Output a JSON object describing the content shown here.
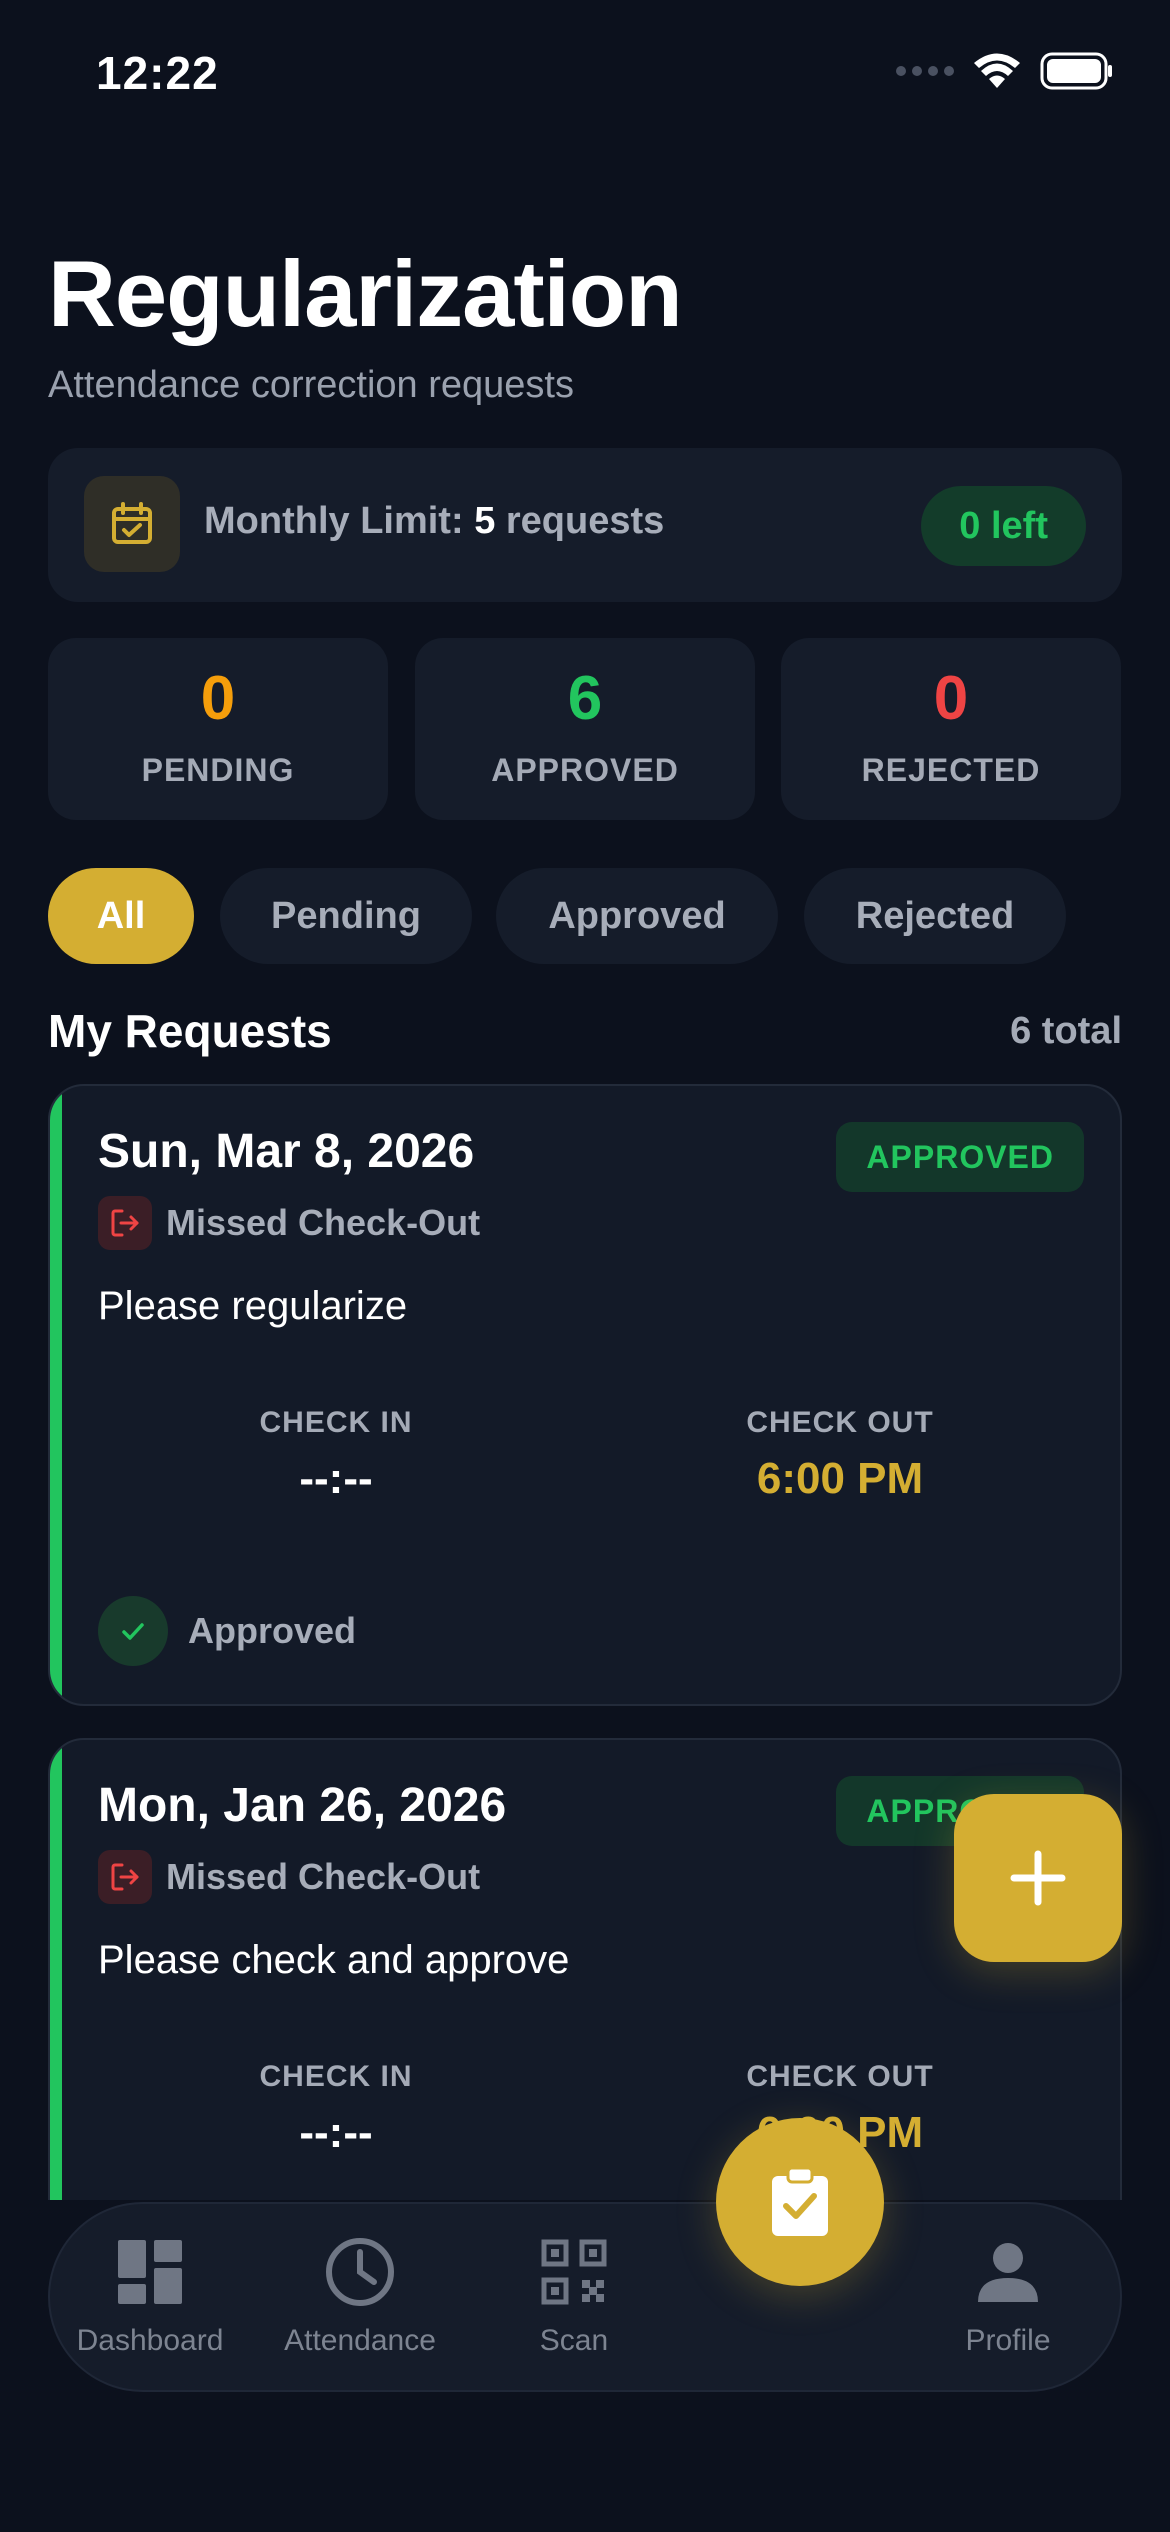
{
  "status_bar": {
    "time": "12:22"
  },
  "header": {
    "title": "Regularization",
    "subtitle": "Attendance correction requests"
  },
  "limit": {
    "label": "Monthly Limit: ",
    "count": "5",
    "unit": " requests",
    "badge": "0 left"
  },
  "stats": [
    {
      "value": "0",
      "label": "PENDING",
      "color": "#f59e0b"
    },
    {
      "value": "6",
      "label": "APPROVED",
      "color": "#22c55e"
    },
    {
      "value": "0",
      "label": "REJECTED",
      "color": "#ef4444"
    }
  ],
  "tabs": [
    {
      "label": "All",
      "active": true
    },
    {
      "label": "Pending",
      "active": false
    },
    {
      "label": "Approved",
      "active": false
    },
    {
      "label": "Rejected",
      "active": false
    }
  ],
  "section": {
    "title": "My Requests",
    "count": "6 total"
  },
  "requests": [
    {
      "date": "Sun, Mar 8, 2026",
      "badge": "APPROVED",
      "type": "Missed Check-Out",
      "note": "Please regularize",
      "check_in_label": "CHECK IN",
      "check_in": "--:--",
      "check_out_label": "CHECK OUT",
      "check_out": "6:00 PM",
      "status": "Approved"
    },
    {
      "date": "Mon, Jan 26, 2026",
      "badge": "APPROVED",
      "type": "Missed Check-Out",
      "note": "Please check and approve",
      "check_in_label": "CHECK IN",
      "check_in": "--:--",
      "check_out_label": "CHECK OUT",
      "check_out": "6:00 PM"
    }
  ],
  "nav": {
    "dashboard": "Dashboard",
    "attendance": "Attendance",
    "scan": "Scan",
    "profile": "Profile"
  },
  "colors": {
    "accent": "#d4ae32",
    "success": "#22c55e",
    "background": "#0c111d"
  }
}
